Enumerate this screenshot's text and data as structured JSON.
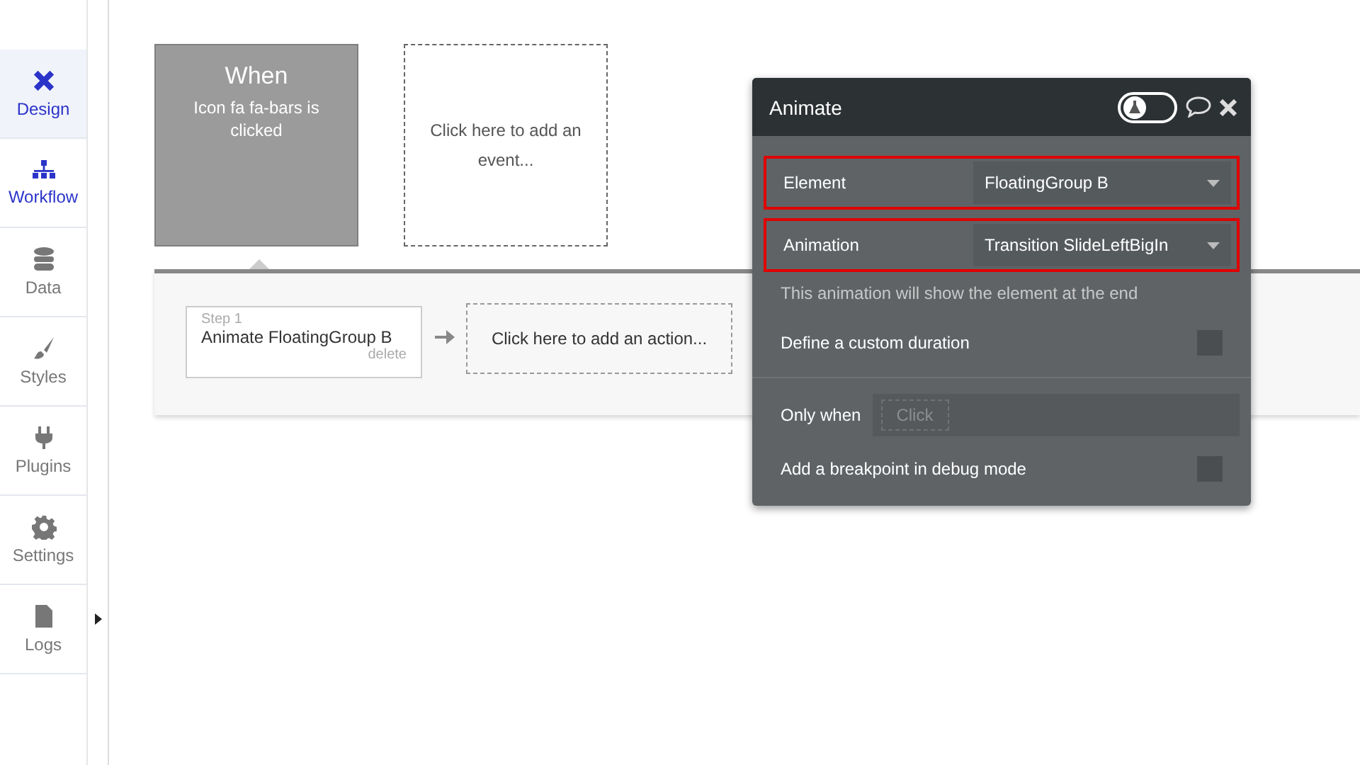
{
  "sidebar": {
    "items": [
      {
        "label": "Design",
        "selected": true,
        "active": true
      },
      {
        "label": "Workflow",
        "selected": false,
        "active": true
      },
      {
        "label": "Data",
        "selected": false,
        "active": false
      },
      {
        "label": "Styles",
        "selected": false,
        "active": false
      },
      {
        "label": "Plugins",
        "selected": false,
        "active": false
      },
      {
        "label": "Settings",
        "selected": false,
        "active": false
      },
      {
        "label": "Logs",
        "selected": false,
        "active": false
      }
    ]
  },
  "event": {
    "heading": "When",
    "description": "Icon fa fa-bars is clicked"
  },
  "add_event": "Click here to add an event...",
  "steps": [
    {
      "step_label": "Step 1",
      "title": "Animate FloatingGroup B",
      "delete": "delete"
    }
  ],
  "add_action": "Click here to add an action...",
  "panel": {
    "title": "Animate",
    "debug_toggle": {
      "on": false
    },
    "fields": [
      {
        "kind": "dropdown",
        "label": "Element",
        "value": "FloatingGroup B",
        "highlighted": true
      },
      {
        "kind": "dropdown",
        "label": "Animation",
        "value": "Transition SlideLeftBigIn",
        "highlighted": true
      },
      {
        "kind": "note",
        "text": "This animation will show the element at the end"
      },
      {
        "kind": "checkbox",
        "label": "Define a custom duration",
        "checked": false
      },
      {
        "kind": "condition",
        "label": "Only when",
        "placeholder": "Click"
      },
      {
        "kind": "checkbox",
        "label": "Add a breakpoint in debug mode",
        "checked": false
      }
    ]
  }
}
